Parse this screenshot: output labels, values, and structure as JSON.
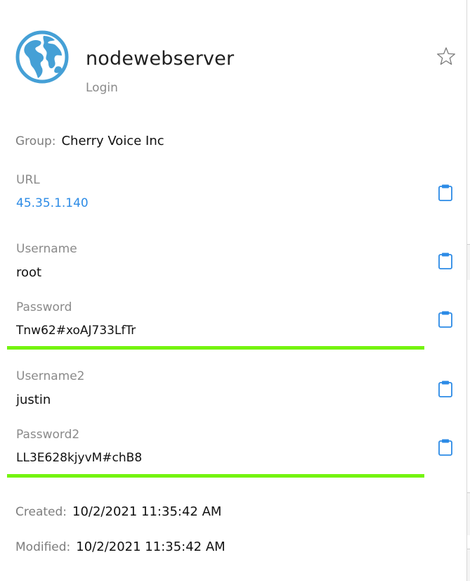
{
  "entry": {
    "title": "nodewebserver",
    "type": "Login",
    "icon": "globe-icon"
  },
  "group": {
    "label": "Group:",
    "value": "Cherry Voice Inc"
  },
  "fields": {
    "url": {
      "label": "URL",
      "value": "45.35.1.140"
    },
    "username": {
      "label": "Username",
      "value": "root"
    },
    "password": {
      "label": "Password",
      "value": "Tnw62#xoAJ733LfTr",
      "strength": 1.0
    },
    "username2": {
      "label": "Username2",
      "value": "justin"
    },
    "password2": {
      "label": "Password2",
      "value": "LL3E628kjyvM#chB8",
      "strength": 1.0
    }
  },
  "meta": {
    "created_label": "Created:",
    "created_value": "10/2/2021 11:35:42 AM",
    "modified_label": "Modified:",
    "modified_value": "10/2/2021 11:35:42 AM"
  },
  "colors": {
    "accent": "#2c8be6",
    "globe": "#45a0d6",
    "strength_bar": "#74f40e",
    "label": "#8a8a8a"
  },
  "icons": {
    "favorite": "star-icon",
    "copy": "clipboard-icon"
  }
}
